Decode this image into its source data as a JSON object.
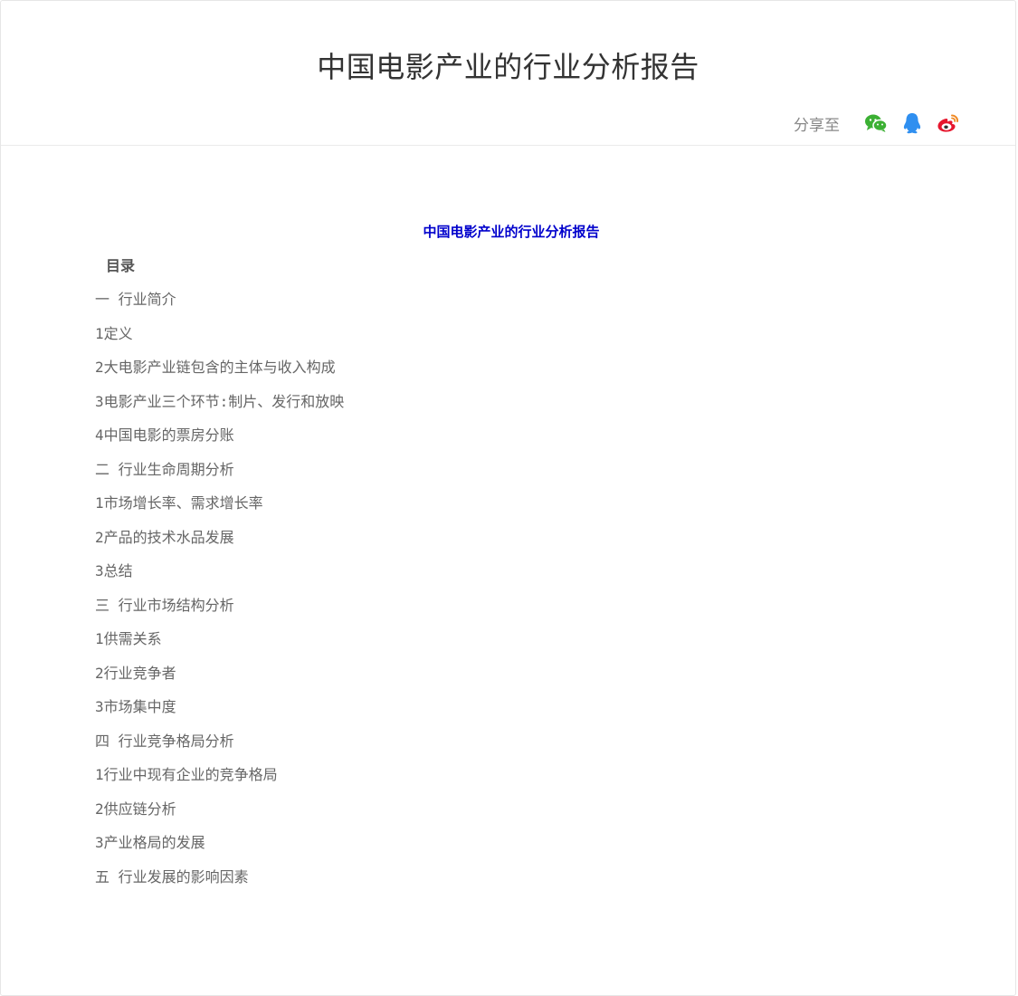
{
  "header": {
    "title": "中国电影产业的行业分析报告",
    "share_label": "分享至"
  },
  "share_icons": [
    {
      "name": "wechat-icon",
      "color": "#3bb033"
    },
    {
      "name": "qq-icon",
      "color": "#2f8ff0"
    },
    {
      "name": "weibo-icon",
      "color": "#e6162d"
    }
  ],
  "content": {
    "title": "中国电影产业的行业分析报告",
    "toc_heading": "目录",
    "toc_items": [
      "一 行业简介",
      "1定义",
      "2大电影产业链包含的主体与收入构成",
      "3电影产业三个环节:制片、发行和放映",
      "4中国电影的票房分账",
      "二 行业生命周期分析",
      "1市场增长率、需求增长率",
      "2产品的技术水品发展",
      "3总结",
      "三 行业市场结构分析",
      "1供需关系",
      "2行业竞争者",
      "3市场集中度",
      "四 行业竞争格局分析",
      "1行业中现有企业的竞争格局",
      "2供应链分析",
      "3产业格局的发展",
      "五 行业发展的影响因素"
    ]
  }
}
